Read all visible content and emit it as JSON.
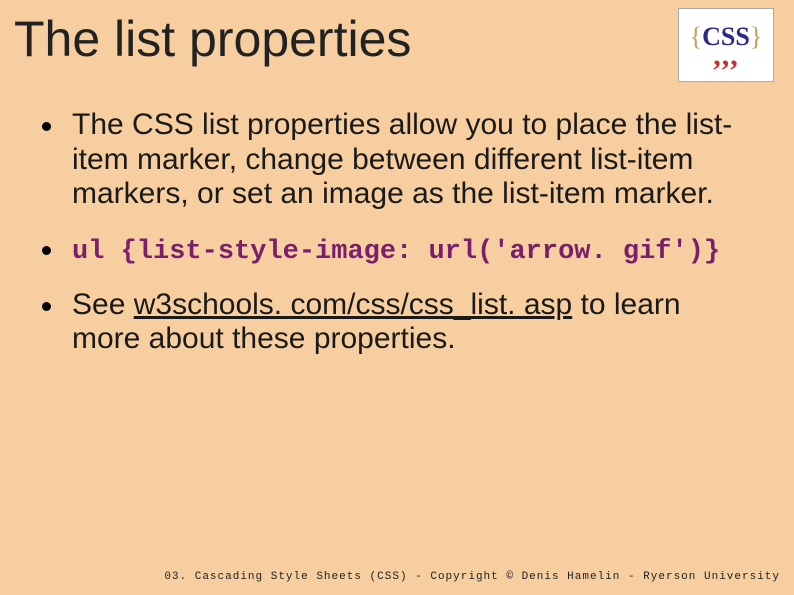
{
  "title": "The list properties",
  "logo": {
    "text_top": "CSS",
    "text_bottom": ",,,"
  },
  "bullets": [
    {
      "text": "The CSS list properties allow you to place the list-item marker, change between different list-item markers, or set an image as the list-item marker."
    },
    {
      "code": "ul {list-style-image: url('arrow. gif')}"
    },
    {
      "prefix": "See ",
      "link_text": "w3schools. com/css/css_list. asp",
      "suffix": " to learn more about these properties."
    }
  ],
  "footer": "03. Cascading Style Sheets (CSS) - Copyright © Denis Hamelin - Ryerson University"
}
